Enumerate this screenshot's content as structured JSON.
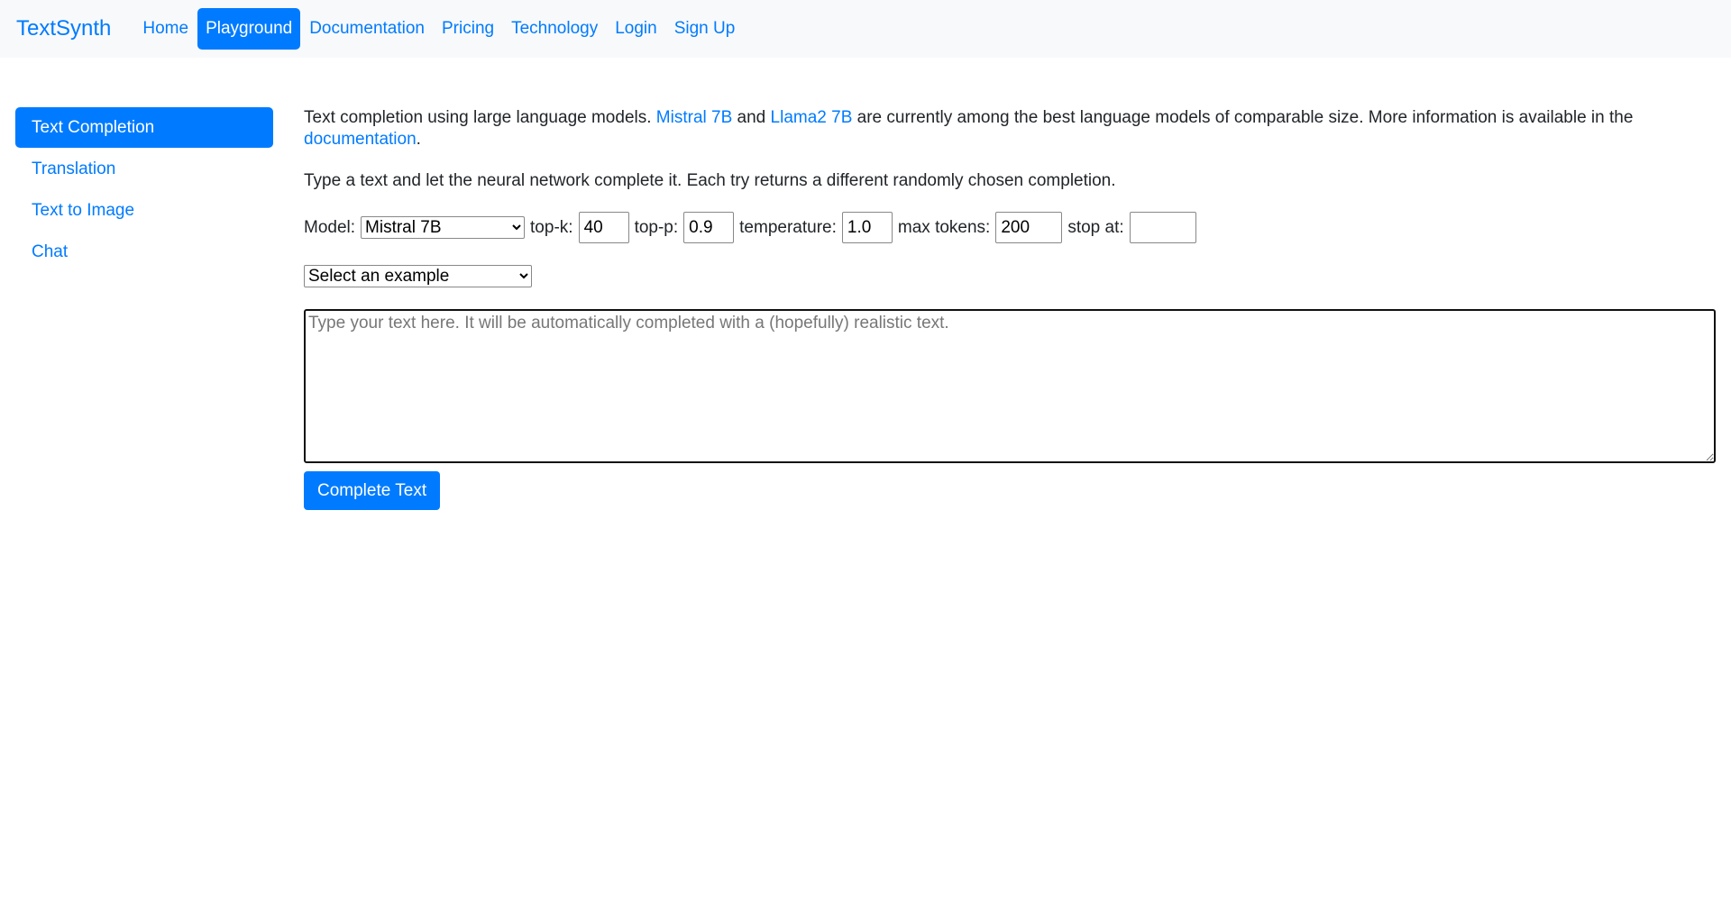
{
  "nav": {
    "brand": "TextSynth",
    "links": [
      "Home",
      "Playground",
      "Documentation",
      "Pricing",
      "Technology",
      "Login",
      "Sign Up"
    ]
  },
  "sidebar": {
    "items": [
      "Text Completion",
      "Translation",
      "Text to Image",
      "Chat"
    ]
  },
  "intro": {
    "t1": "Text completion using large language models. ",
    "l1": "Mistral 7B",
    "t2": " and ",
    "l2": "Llama2 7B",
    "t3": " are currently among the best language models of comparable size. More information is available in the ",
    "l3": "documentation",
    "t4": "."
  },
  "instruction": "Type a text and let the neural network complete it. Each try returns a different randomly chosen completion.",
  "params": {
    "model_label": "Model:",
    "model": "Mistral 7B",
    "topk_label": "top-k:",
    "topk": "40",
    "topp_label": "top-p:",
    "topp": "0.9",
    "temp_label": "temperature:",
    "temp": "1.0",
    "max_label": "max tokens:",
    "max": "200",
    "stop_label": "stop at:",
    "stop": ""
  },
  "example_select": "Select an example",
  "textarea_placeholder": "Type your text here. It will be automatically completed with a (hopefully) realistic text.",
  "submit": "Complete Text"
}
